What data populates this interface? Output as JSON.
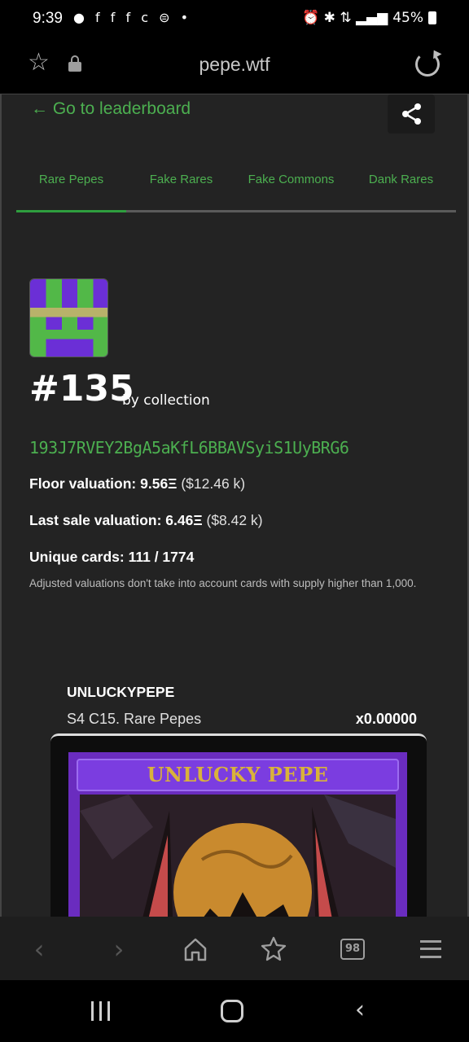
{
  "status_bar": {
    "time": "9:39",
    "notification_icons": "● f f f c ⊜ •",
    "battery_percent": "45%",
    "system_icons": "⏰ ✱ ⇅ ▂▄▆"
  },
  "browser": {
    "url": "pepe.wtf",
    "tab_count": "98"
  },
  "page": {
    "back_link": "← Go to leaderboard",
    "tabs": [
      {
        "label": "Rare Pepes",
        "active": true
      },
      {
        "label": "Fake Rares",
        "active": false
      },
      {
        "label": "Fake Commons",
        "active": false
      },
      {
        "label": "Dank Rares",
        "active": false
      }
    ],
    "rank": "#135",
    "rank_by": "by collection",
    "address": "193J7RVEY2BgA5aKfL6BBAVSyiS1UyBRG6",
    "floor_label": "Floor valuation:",
    "floor_value": "9.56Ξ",
    "floor_usd": "($12.46 k)",
    "last_sale_label": "Last sale valuation:",
    "last_sale_value": "6.46Ξ",
    "last_sale_usd": "($8.42 k)",
    "unique_label": "Unique cards:",
    "unique_value": "111 / 1774",
    "note": "Adjusted valuations don't take into account cards with supply higher than 1,000.",
    "card": {
      "name": "UNLUCKYPEPE",
      "series": "S4 C15. Rare Pepes",
      "quantity": "x0.00000",
      "art_title": "UNLUCKY PEPE"
    }
  },
  "colors": {
    "accent_green": "#4caf50",
    "page_bg": "#232323",
    "card_purple": "#6a2cbf"
  }
}
